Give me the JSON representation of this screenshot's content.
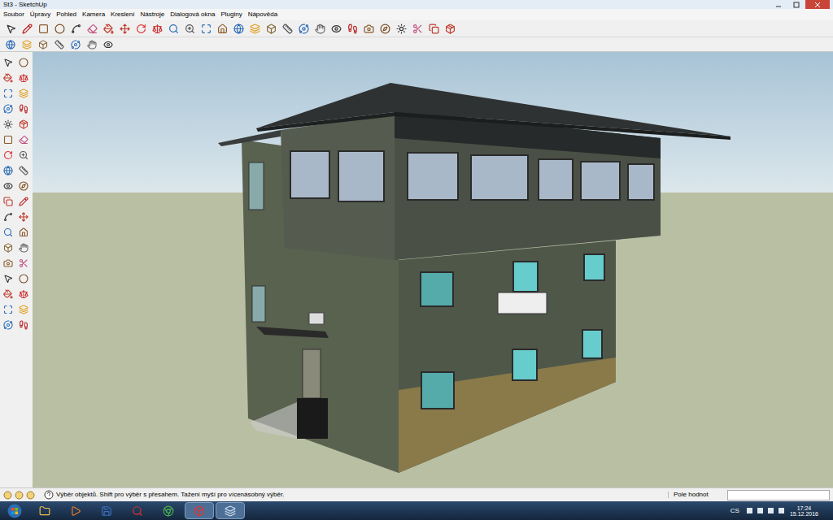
{
  "window": {
    "title": "St3 - SketchUp"
  },
  "menu": [
    "Soubor",
    "Úpravy",
    "Pohled",
    "Kamera",
    "Kreslení",
    "Nástroje",
    "Dialogová okna",
    "Pluginy",
    "Nápověda"
  ],
  "status_bar": {
    "hint": "Výběr objektů. Shift pro výběr s přesahem. Tažení myší pro vícenásobný výběr.",
    "value_label": "Pole hodnot"
  },
  "taskbar": {
    "language": "CS",
    "time": "17:24",
    "date": "15.12.2016"
  }
}
